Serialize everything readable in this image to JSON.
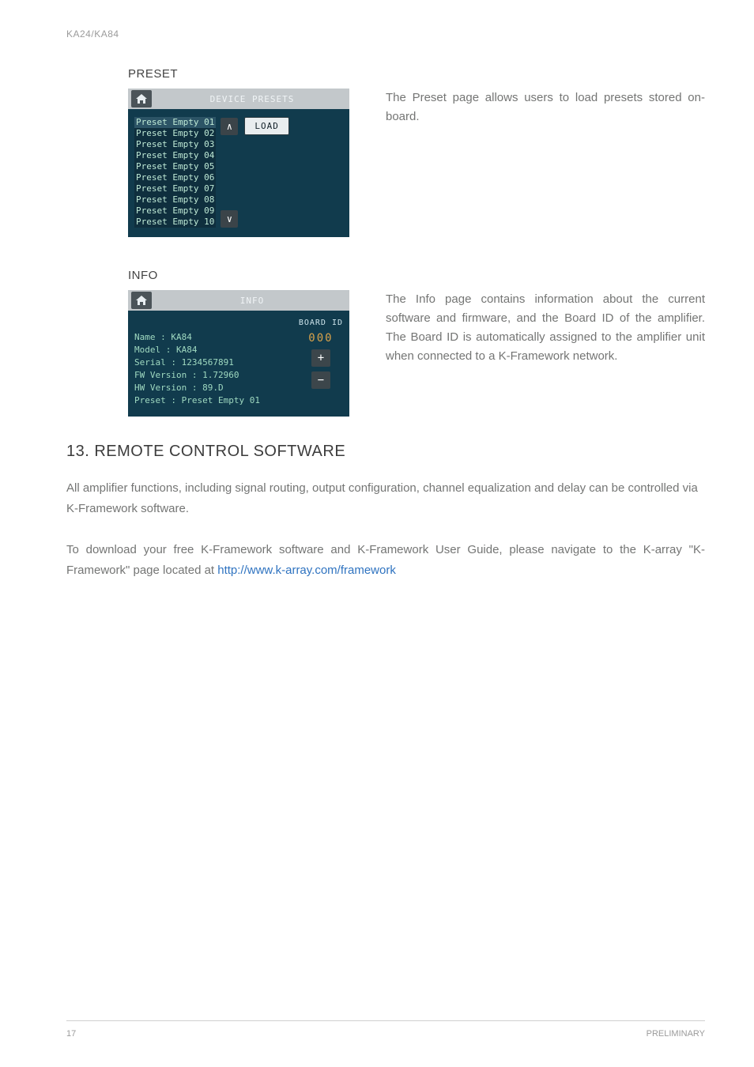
{
  "header": {
    "doc_label": "KA24/KA84"
  },
  "preset": {
    "heading": "PRESET",
    "panel_title": "DEVICE PRESETS",
    "items": [
      "Preset Empty 01",
      "Preset Empty 02",
      "Preset Empty 03",
      "Preset Empty 04",
      "Preset Empty 05",
      "Preset Empty 06",
      "Preset Empty 07",
      "Preset Empty 08",
      "Preset Empty 09",
      "Preset Empty 10"
    ],
    "load_label": "LOAD",
    "description": "The Preset page allows users to load presets stored on-board."
  },
  "info": {
    "heading": "INFO",
    "panel_title": "INFO",
    "lines": {
      "name": "Name : KA84",
      "model": "Model : KA84",
      "serial": "Serial : 1234567891",
      "fw": "FW Version : 1.72960",
      "hw": "HW Version : 89.D",
      "preset": "Preset : Preset Empty 01"
    },
    "board_label": "BOARD ID",
    "board_value": "000",
    "description": "The Info page contains information about the current software and firmware, and the Board ID of the amplifier. The Board ID is automatically assigned to the amplifier unit when connected to a K-Framework network."
  },
  "section13": {
    "heading": "13. REMOTE CONTROL SOFTWARE",
    "p1": "All amplifier functions, including signal routing, output configuration, channel equalization and delay can be controlled via K-Framework software.",
    "p2a": "To download your free K-Framework software and K-Framework User Guide, please navigate to the K-array \"K-Framework\" page located at ",
    "p2_link": "http://www.k-array.com/framework"
  },
  "footer": {
    "page": "17",
    "status": "PRELIMINARY"
  }
}
